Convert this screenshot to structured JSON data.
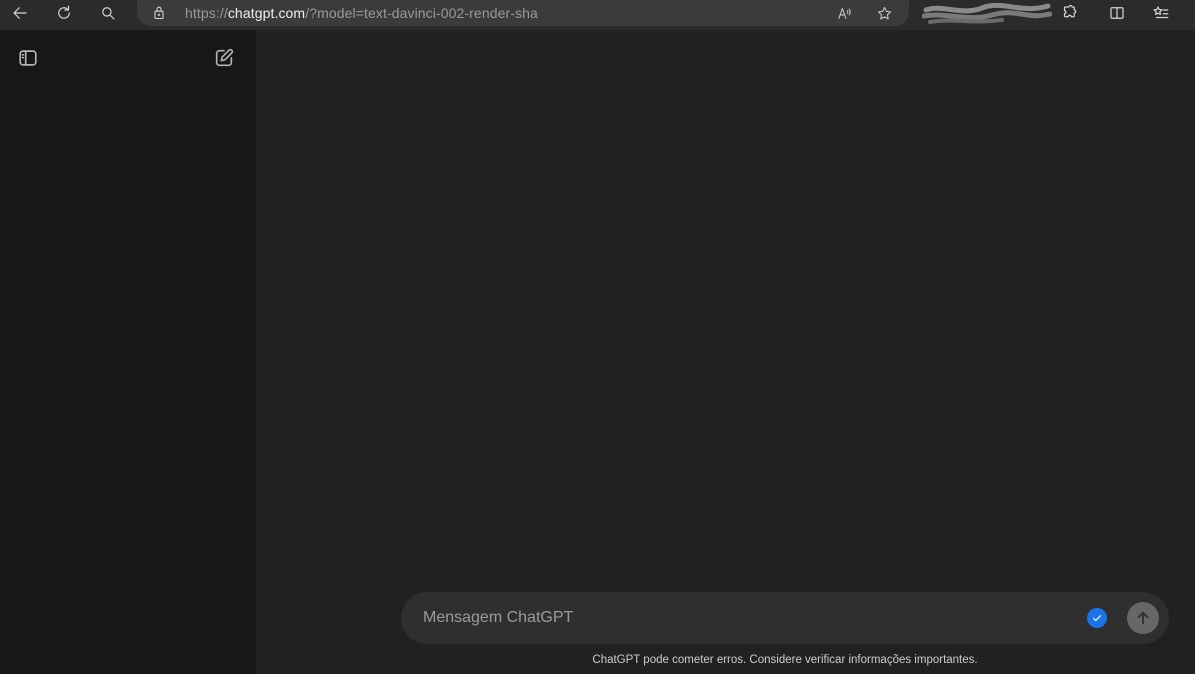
{
  "browser": {
    "url_prefix": "https://",
    "url_host": "chatgpt.com",
    "url_path": "/?model=text-davinci-002-render-sha",
    "icons": {
      "back": "back-arrow-icon",
      "reload": "reload-icon",
      "search": "search-icon",
      "lock": "lock-icon",
      "read_aloud": "read-aloud-icon",
      "favorite": "star-icon",
      "extensions": "extensions-icon",
      "split_screen": "split-screen-icon",
      "favorites_list": "favorites-list-icon"
    }
  },
  "sidebar": {
    "toggle_icon": "sidebar-toggle-icon",
    "new_chat_icon": "new-chat-icon"
  },
  "composer": {
    "placeholder": "Mensagem ChatGPT",
    "value": "",
    "check_icon": "check-circle-icon",
    "send_icon": "send-arrow-icon"
  },
  "footer": {
    "disclaimer": "ChatGPT pode cometer erros. Considere verificar informações importantes."
  },
  "colors": {
    "sidebar_bg": "#171717",
    "main_bg": "#212121",
    "composer_bg": "#2f2f2f",
    "check_badge": "#1a73e8",
    "send_button": "#676767"
  }
}
